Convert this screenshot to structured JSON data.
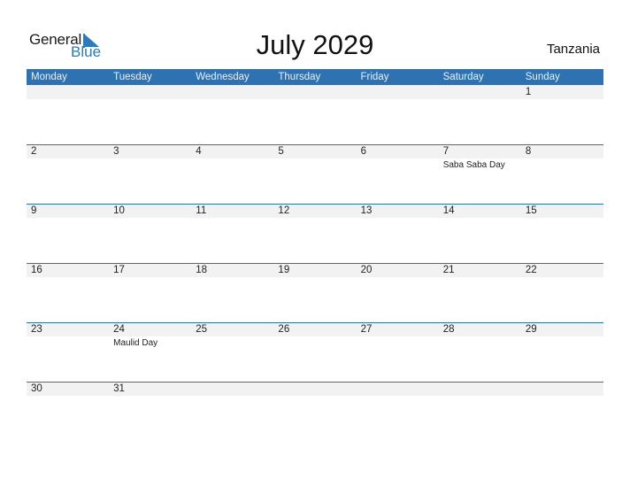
{
  "logo": {
    "general": "General",
    "blue": "Blue"
  },
  "title": "July 2029",
  "country": "Tanzania",
  "accent": "#2f72b2",
  "days": [
    "Monday",
    "Tuesday",
    "Wednesday",
    "Thursday",
    "Friday",
    "Saturday",
    "Sunday"
  ],
  "weeks": [
    [
      "",
      "",
      "",
      "",
      "",
      "",
      "1"
    ],
    [
      "2",
      "3",
      "4",
      "5",
      "6",
      "7",
      "8"
    ],
    [
      "9",
      "10",
      "11",
      "12",
      "13",
      "14",
      "15"
    ],
    [
      "16",
      "17",
      "18",
      "19",
      "20",
      "21",
      "22"
    ],
    [
      "23",
      "24",
      "25",
      "26",
      "27",
      "28",
      "29"
    ],
    [
      "30",
      "31",
      "",
      "",
      "",
      "",
      ""
    ]
  ],
  "events": [
    [
      "",
      "",
      "",
      "",
      "",
      "",
      ""
    ],
    [
      "",
      "",
      "",
      "",
      "",
      "Saba Saba Day",
      ""
    ],
    [
      "",
      "",
      "",
      "",
      "",
      "",
      ""
    ],
    [
      "",
      "",
      "",
      "",
      "",
      "",
      ""
    ],
    [
      "",
      "Maulid Day",
      "",
      "",
      "",
      "",
      ""
    ],
    [
      "",
      "",
      "",
      "",
      "",
      "",
      ""
    ]
  ]
}
